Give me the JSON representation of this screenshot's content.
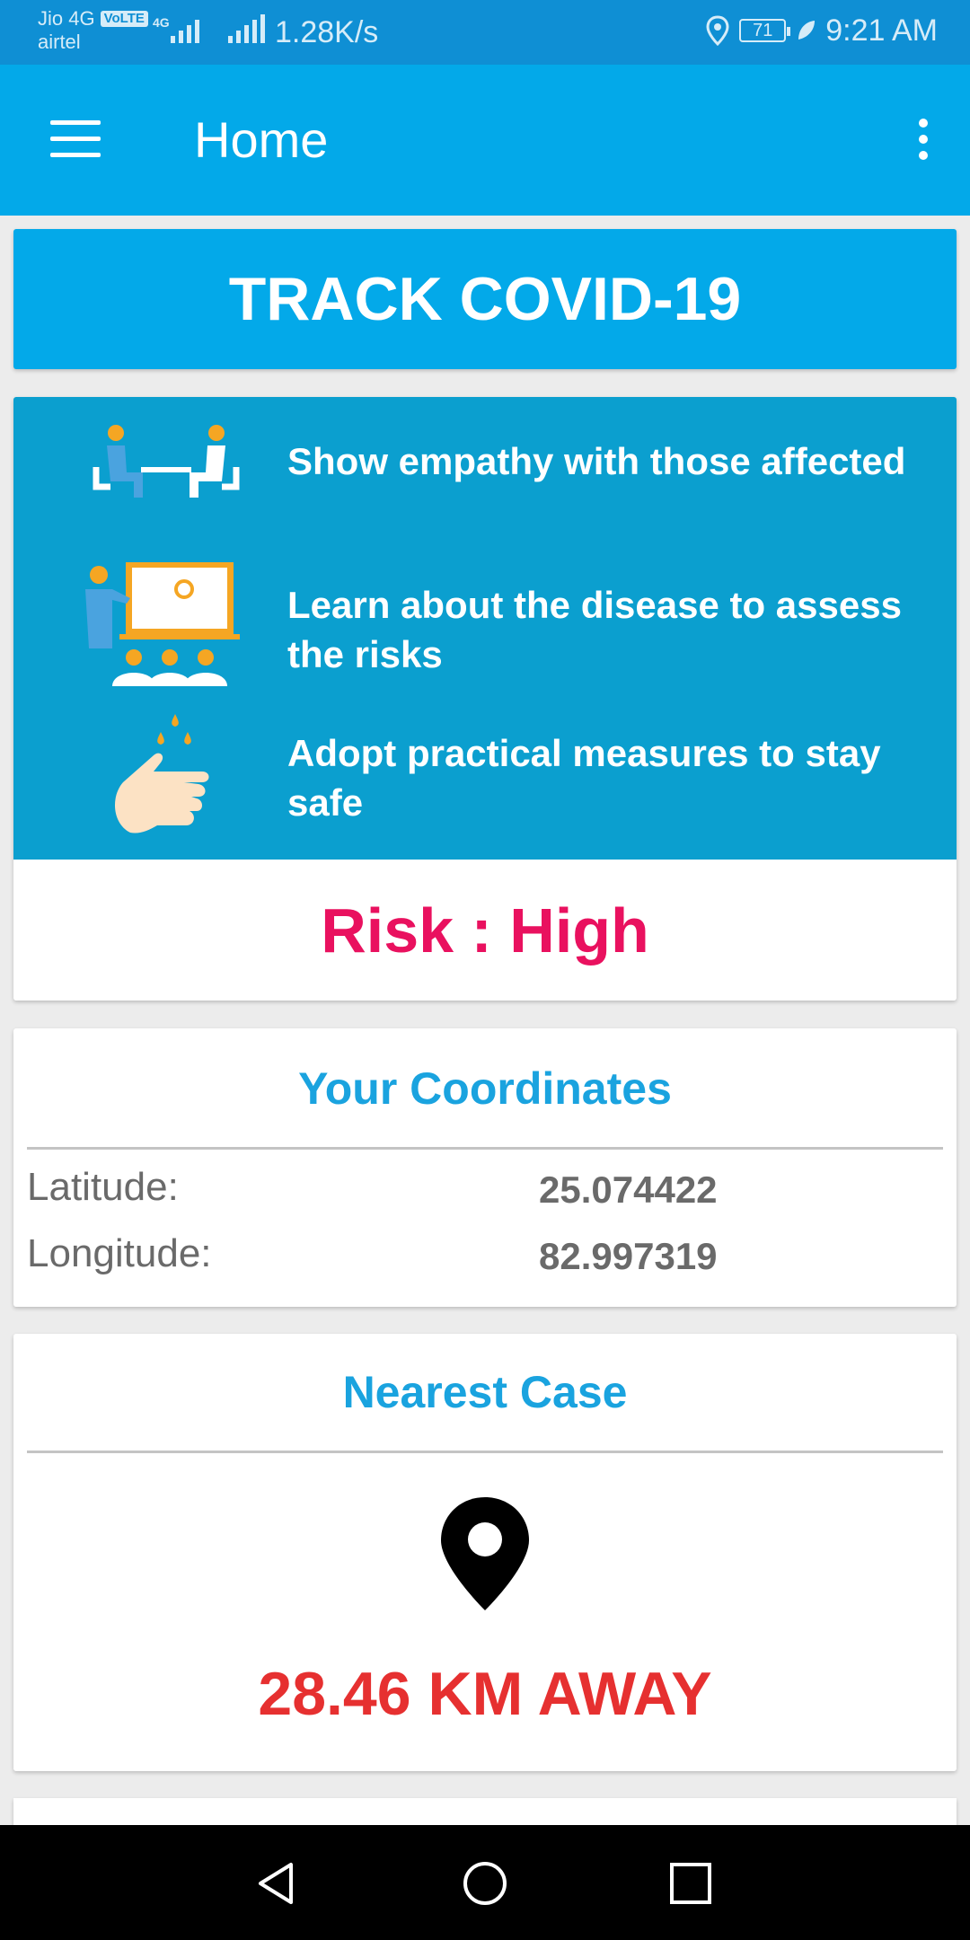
{
  "status_bar": {
    "carrier_primary": "Jio 4G",
    "volte_badge": "VoLTE",
    "carrier_secondary": "airtel",
    "network_small": "4G",
    "speed": "1.28K/s",
    "battery": "71",
    "time": "9:21 AM"
  },
  "app_bar": {
    "title": "Home"
  },
  "banner": {
    "title": "TRACK COVID-19"
  },
  "tips": [
    {
      "text": "Show empathy with those affected",
      "icon": "people-table-icon"
    },
    {
      "text": "Learn about the disease to assess the risks",
      "icon": "presentation-icon"
    },
    {
      "text": "Adopt practical measures to stay safe",
      "icon": "handwash-icon"
    }
  ],
  "risk": {
    "text": "Risk : High",
    "color": "#e9115f"
  },
  "coordinates": {
    "title": "Your Coordinates",
    "latitude_label": "Latitude:",
    "latitude_value": "25.074422",
    "longitude_label": "Longitude:",
    "longitude_value": "82.997319"
  },
  "nearest_case": {
    "title": "Nearest Case",
    "icon": "location-pin-icon",
    "distance": "28.46 KM AWAY"
  },
  "colors": {
    "status_bar": "#0f8fd4",
    "primary": "#03a9e9",
    "tips_bg": "#0b9fcf",
    "title_blue": "#1aa3df",
    "distance_red": "#e63030"
  },
  "nav_bar": {
    "back": "back-icon",
    "home": "home-icon",
    "recents": "recents-icon"
  }
}
